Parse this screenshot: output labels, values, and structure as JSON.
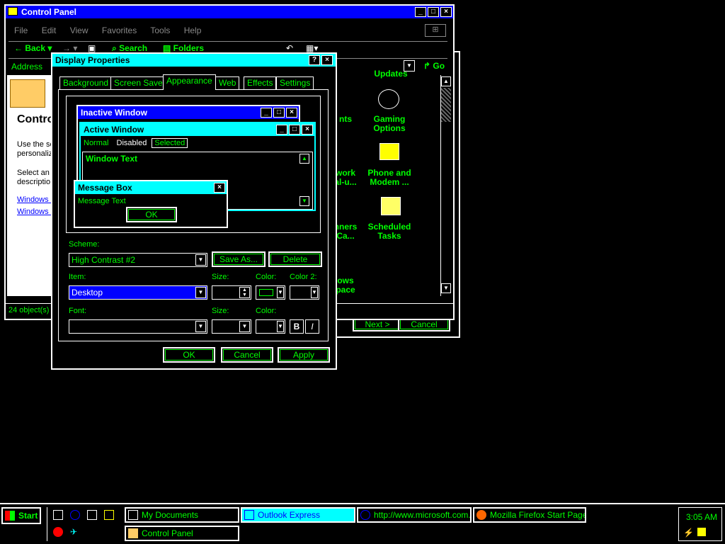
{
  "colors": {
    "title_inactive": "#0000ff",
    "title_active": "#00ffff",
    "text": "#00ff00",
    "highlight": "#0000ff"
  },
  "control_panel": {
    "title": "Control Panel",
    "menu": [
      "File",
      "Edit",
      "View",
      "Favorites",
      "Tools",
      "Help"
    ],
    "toolbar": {
      "back": "Back",
      "search": "Search",
      "folders": "Folders"
    },
    "address_label": "Address",
    "go_label": "Go",
    "left_heading": "Contro",
    "left_text_1a": "Use the se",
    "left_text_1b": "personaliz",
    "left_text_2a": "Select an",
    "left_text_2b": "descriptio",
    "link_1": "Windows I",
    "link_2": "Windows .",
    "status": "24 object(s)",
    "icons": {
      "updates": "Updates",
      "fonts": "nts",
      "network_1": "work",
      "network_2": "al-u...",
      "scanners_1": "nners",
      "scanners_2": "Ca...",
      "windows_1": "ows",
      "windows_2": "pace",
      "gaming_1": "Gaming",
      "gaming_2": "Options",
      "phone_1": "Phone and",
      "phone_2": "Modem ...",
      "sched_1": "Scheduled",
      "sched_2": "Tasks"
    }
  },
  "wizard": {
    "next": "Next >",
    "cancel": "Cancel"
  },
  "display_properties": {
    "title": "Display Properties",
    "tabs": [
      "Background",
      "Screen Saver",
      "Appearance",
      "Web",
      "Effects",
      "Settings"
    ],
    "preview": {
      "inactive_title": "Inactive Window",
      "active_title": "Active Window",
      "menu_normal": "Normal",
      "menu_disabled": "Disabled",
      "menu_selected": "Selected",
      "window_text": "Window Text",
      "msgbox_title": "Message Box",
      "msgbox_text": "Message Text",
      "msgbox_ok": "OK"
    },
    "scheme_label": "Scheme:",
    "scheme_value": "High Contrast #2",
    "save_as": "Save As...",
    "delete": "Delete",
    "item_label": "Item:",
    "item_value": "Desktop",
    "size_label": "Size:",
    "color_label": "Color:",
    "color2_label": "Color 2:",
    "font_label": "Font:",
    "font_size_label": "Size:",
    "font_color_label": "Color:",
    "bold": "B",
    "italic": "I",
    "ok": "OK",
    "cancel": "Cancel",
    "apply": "Apply"
  },
  "taskbar": {
    "start": "Start",
    "tasks": [
      "My Documents",
      "Outlook Express",
      "http://www.microsoft.com...",
      "Mozilla Firefox Start Page -...",
      "Control Panel"
    ],
    "clock": "3:05 AM"
  }
}
